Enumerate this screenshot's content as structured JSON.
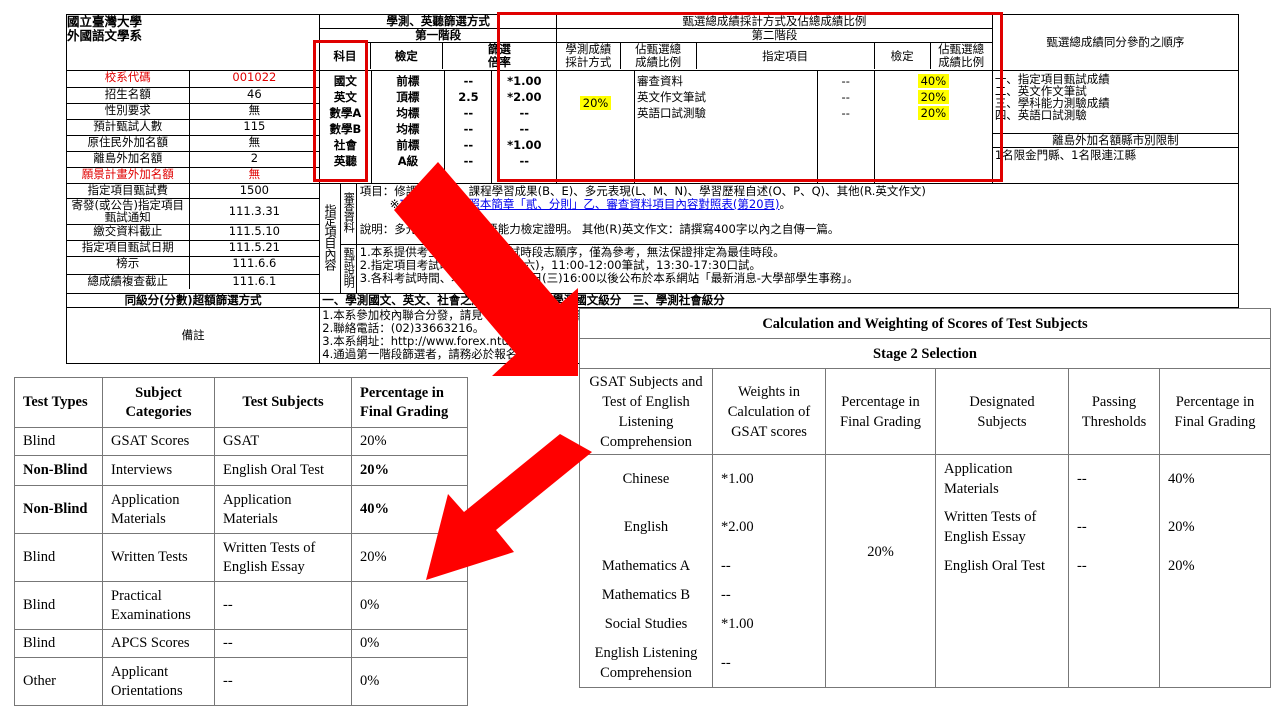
{
  "header": {
    "university": "國立臺灣大學",
    "department": "外國語文學系",
    "screening_title": "學測、英聽篩選方式",
    "stage1": "第一階段",
    "methods_title": "甄選總成績採計方式及佔總成績比例",
    "stage2": "第二階段",
    "tiebreak_title": "甄選總成績同分參酌之順序"
  },
  "col_headers": {
    "subject": "科目",
    "threshold": "檢定",
    "ratio_a": "篩選",
    "ratio_b": "倍率",
    "gsat_a": "學測成績",
    "gsat_b": "採計方式",
    "pct_a": "佔甄選總",
    "pct_b": "成績比例",
    "designated": "指定項目",
    "check": "檢定",
    "pct2_a": "佔甄選總",
    "pct2_b": "成績比例"
  },
  "info_rows": [
    {
      "label": "校系代碼",
      "value": "001022"
    },
    {
      "label": "招生名額",
      "value": "46"
    },
    {
      "label": "性別要求",
      "value": "無"
    },
    {
      "label": "預計甄試人數",
      "value": "115"
    },
    {
      "label": "原住民外加名額",
      "value": "無"
    },
    {
      "label": "離島外加名額",
      "value": "2"
    },
    {
      "label": "願景計畫外加名額",
      "value": "無"
    }
  ],
  "subjects": [
    "國文",
    "英文",
    "數學A",
    "數學B",
    "社會",
    "英聽"
  ],
  "thresholds": [
    "前標",
    "頂標",
    "均標",
    "均標",
    "前標",
    "A級"
  ],
  "ratios": [
    "--",
    "2.5",
    "--",
    "--",
    "--",
    "--"
  ],
  "gsat_method": [
    "*1.00",
    "*2.00",
    "--",
    "--",
    "*1.00",
    "--"
  ],
  "gsat_percent": "20%",
  "designated_items": [
    "審查資料",
    "英文作文筆試",
    "英語口試測驗"
  ],
  "designated_checks": [
    "--",
    "--",
    "--"
  ],
  "designated_percents": [
    "40%",
    "20%",
    "20%"
  ],
  "tiebreak_items": [
    "一、指定項目甄試成績",
    "二、英文作文筆試",
    "三、學科能力測驗成績",
    "四、英語口試測驗"
  ],
  "island_title": "離島外加名額縣市別限制",
  "island_value": "1名限金門縣、1名限連江縣",
  "date_rows": [
    {
      "label": "指定項目甄試費",
      "value": "1500"
    },
    {
      "label": "寄發(或公告)指定項目甄試通知",
      "value": "111.3.31"
    },
    {
      "label": "繳交資料截止",
      "value": "111.5.10"
    },
    {
      "label": "指定項目甄試日期",
      "value": "111.5.21"
    },
    {
      "label": "榜示",
      "value": "111.6.6"
    },
    {
      "label": "總成績複查截止",
      "value": "111.6.1"
    }
  ],
  "vertical_label": "指定項目內容",
  "review_label": "審查資料",
  "exam_label": "甄試說明",
  "review_line1": "項目：修課紀錄(A)、課程學習成果(B、E)、多元表現(L、M、N)、學習歷程自述(O、P、Q)、其他(R.英文作文)",
  "review_line2_prefix": "※",
  "review_line2_link": "項目代碼請參照本簡章「貳、分則」乙、審查資料項目內容對照表(第20頁)",
  "review_line2_suffix": "。",
  "review_line3": "說明：多元表現請提供英語能力檢定證明。 其他(R)英文作文：請撰寫400字以內之自傳一篇。",
  "exam_lines": [
    "1.本系提供考生於網路填寫口試時段志願序，僅為參考，無法保證排定為最佳時段。",
    "2.指定項目考試時間：5月21日(六)，11:00-12:00筆試，13:30-17:30口試。",
    "3.各科考試時間、地點將於5月18日(三)16:00以後公布於本系網站「最新消息-大學部學生事務」。"
  ],
  "same_level_label": "同級分(分數)超額篩選方式",
  "same_level_value": "一、學測國文、英文、社會之級分總和　二、學測國文級分　三、學測社會級分",
  "notes_label": "備註",
  "notes_lines": [
    "1.本系參加校內聯合分發，請見「招生簡章」相關事項。",
    "2.聯絡電話：(02)33663216。",
    "3.本系網址：http://www.forex.ntu.edu.tw",
    "4.通過第一階段篩選者，請務必於報名時填寫"
  ],
  "left_table": {
    "headers": [
      "Test Types",
      "Subject Categories",
      "Test Subjects",
      "Percentage in Final Grading"
    ],
    "rows": [
      {
        "type": "Blind",
        "category": "GSAT Scores",
        "subject": "GSAT",
        "percent": "20%",
        "bold": false
      },
      {
        "type": "Non-Blind",
        "category": "Interviews",
        "subject": "English  Oral Test",
        "percent": "20%",
        "bold": true
      },
      {
        "type": "Non-Blind",
        "category": "Application Materials",
        "subject": "Application Materials",
        "percent": "40%",
        "bold": true
      },
      {
        "type": "Blind",
        "category": "Written Tests",
        "subject": "Written Tests of English Essay",
        "percent": "20%",
        "bold": false
      },
      {
        "type": "Blind",
        "category": "Practical Examinations",
        "subject": "--",
        "percent": "0%",
        "bold": false
      },
      {
        "type": "Blind",
        "category": "APCS Scores",
        "subject": "--",
        "percent": "0%",
        "bold": false
      },
      {
        "type": "Other",
        "category": "Applicant Orientations",
        "subject": "--",
        "percent": "0%",
        "bold": false
      }
    ]
  },
  "right_table": {
    "title": "Calculation  and  Weighting  of Scores of Test Subjects",
    "stage": "Stage 2 Selection",
    "headers": [
      "GSAT Subjects and Test of English Listening Comprehension",
      "Weights  in Calculation  of GSAT scores",
      "Percentage  in Final Grading",
      "Designated Subjects",
      "Passing Thresholds",
      "Percentage  in Final  Grading"
    ],
    "subjects": [
      "Chinese",
      "English",
      "Mathematics  A",
      "Mathematics  B",
      "Social  Studies",
      "English  Listening Comprehension"
    ],
    "weights": [
      "*1.00",
      "*2.00",
      "--",
      "--",
      "*1.00",
      "--"
    ],
    "gsat_percent": "20%",
    "designated": [
      "Application Materials",
      "Written  Tests  of English  Essay",
      "English  Oral Test"
    ],
    "thresholds": [
      "--",
      "--",
      "--"
    ],
    "percents": [
      "40%",
      "20%",
      "20%"
    ]
  },
  "colors": {
    "highlight": "#ffff00",
    "annotation_red": "#e00000",
    "link_blue": "#0000ee"
  }
}
